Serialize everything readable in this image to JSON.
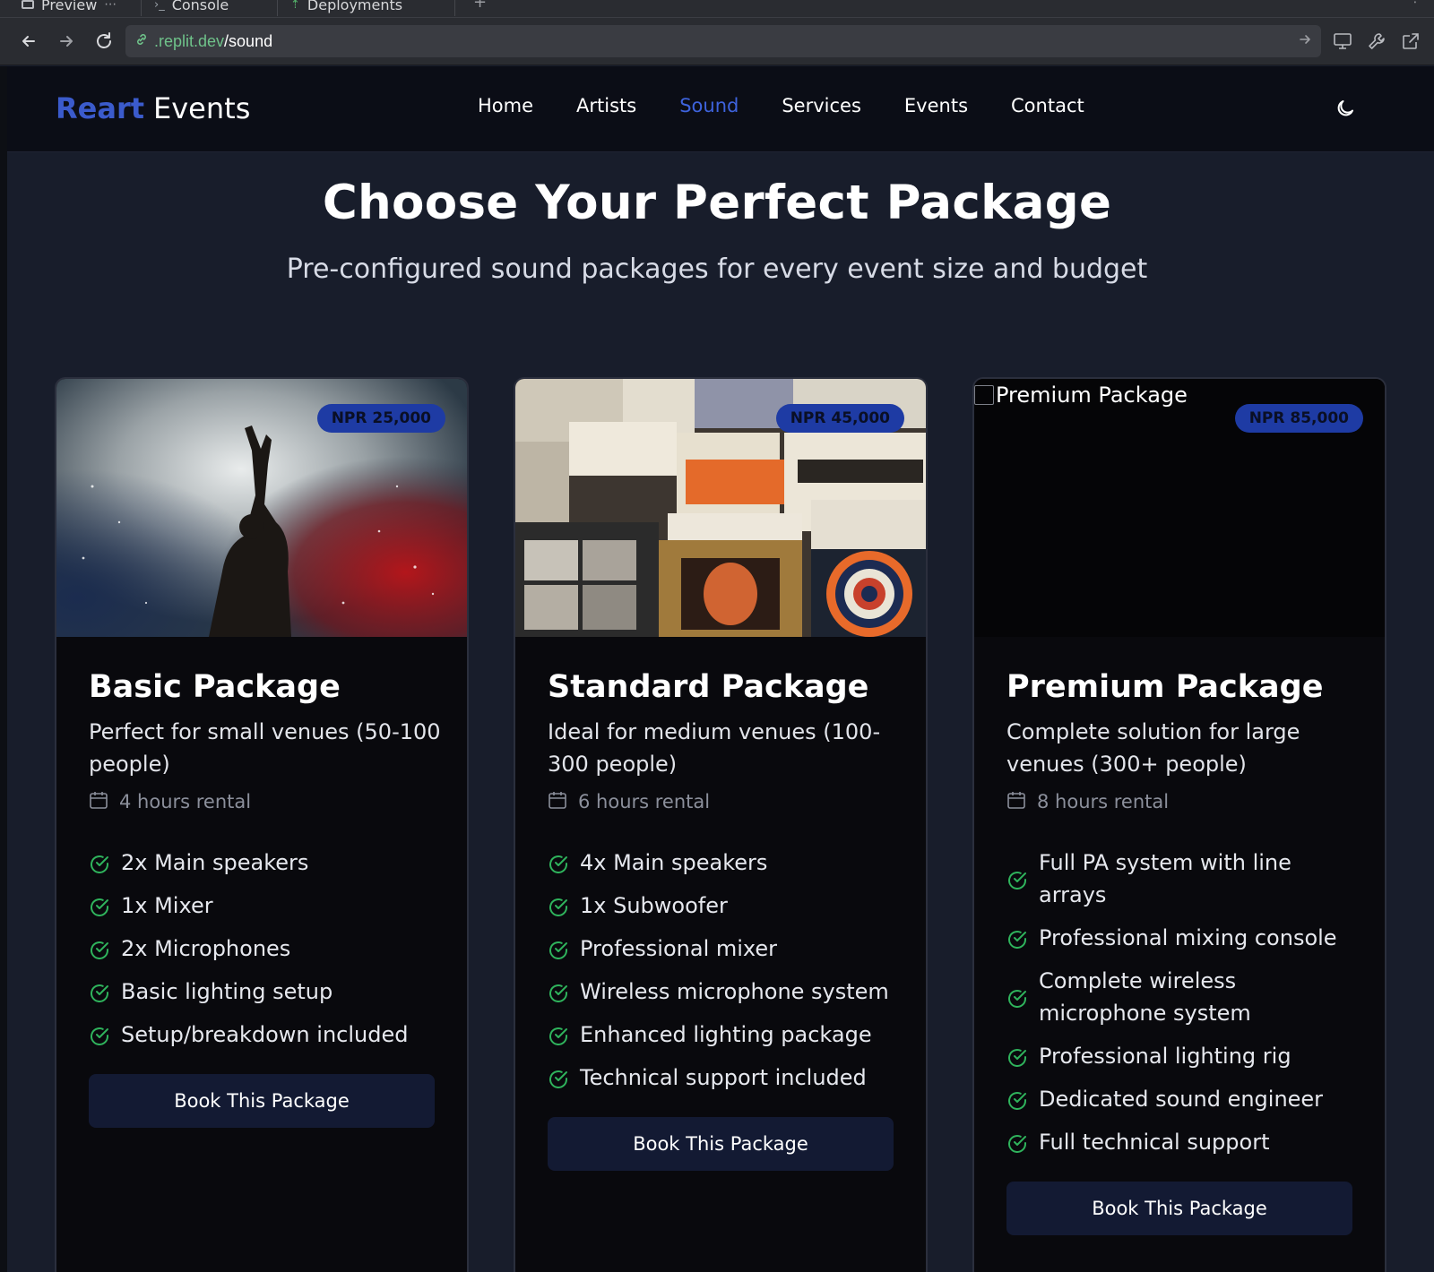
{
  "browser": {
    "tabs": [
      {
        "label": "Preview"
      },
      {
        "label": "Console"
      },
      {
        "label": "Deployments"
      }
    ],
    "url_domain": ".replit.dev",
    "url_path": "/sound"
  },
  "nav": {
    "brand_main": "Reart",
    "brand_sub": "Events",
    "links": [
      "Home",
      "Artists",
      "Sound",
      "Services",
      "Events",
      "Contact"
    ],
    "active": "Sound"
  },
  "hero": {
    "title": "Choose Your Perfect Package",
    "subtitle": "Pre-configured sound packages for every event size and budget"
  },
  "packages": [
    {
      "title": "Basic Package",
      "price": "NPR 25,000",
      "description": "Perfect for small venues (50-100 people)",
      "rental": "4 hours rental",
      "features": [
        "2x Main speakers",
        "1x Mixer",
        "2x Microphones",
        "Basic lighting setup",
        "Setup/breakdown included"
      ],
      "button": "Book This Package",
      "image": "concert-performer-photo"
    },
    {
      "title": "Standard Package",
      "price": "NPR 45,000",
      "description": "Ideal for medium venues (100-300 people)",
      "rental": "6 hours rental",
      "features": [
        "4x Main speakers",
        "1x Subwoofer",
        "Professional mixer",
        "Wireless microphone system",
        "Enhanced lighting package",
        "Technical support included"
      ],
      "button": "Book This Package",
      "image": "vinyl-records-photo"
    },
    {
      "title": "Premium Package",
      "price": "NPR 85,000",
      "description": "Complete solution for large venues (300+ people)",
      "rental": "8 hours rental",
      "features": [
        "Full PA system with line arrays",
        "Professional mixing console",
        "Complete wireless microphone system",
        "Professional lighting rig",
        "Dedicated sound engineer",
        "Full technical support"
      ],
      "button": "Book This Package",
      "image_alt": "Premium Package"
    }
  ],
  "colors": {
    "page_bg": "#181d2b",
    "nav_bg": "#0b0d16",
    "card_bg": "#09090d",
    "accent": "#3e63dd",
    "badge": "#1e3ba4",
    "check": "#2fb35c",
    "button_bg": "#131a33"
  }
}
